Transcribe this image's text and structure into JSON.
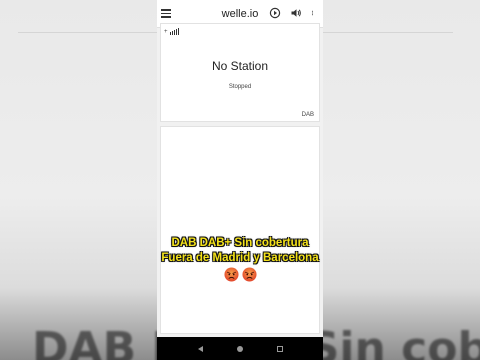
{
  "app": {
    "title": "welle.io",
    "icons": [
      "menu-icon",
      "play-icon",
      "volume-icon",
      "more-vert-icon"
    ]
  },
  "station_card": {
    "station_name": "No Station",
    "status": "Stopped",
    "mode": "DAB",
    "signal_indicator": "+"
  },
  "overlay": {
    "line1": "DAB DAB+ Sin cobertura",
    "line2": "Fuera de Madrid y Barcelona",
    "emojis": [
      "angry-face-icon",
      "angry-face-icon"
    ]
  },
  "background_caption": "DAB DAB+ Sin cobertura",
  "colors": {
    "caption": "#f4e21a",
    "caption_outline": "#111111",
    "app_bar": "#ffffff",
    "screen_background": "#f1f1f1"
  }
}
